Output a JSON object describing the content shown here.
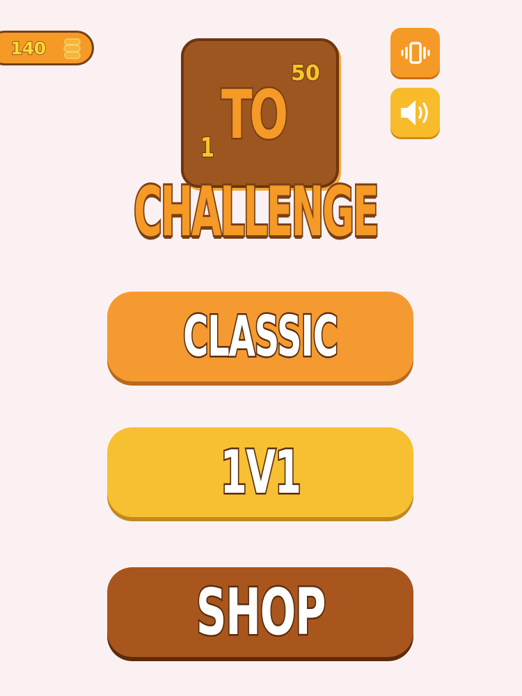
{
  "hud": {
    "coins": "140",
    "coin_icon": "coin-stack-icon",
    "vibration_icon": "vibration-icon",
    "sound_icon": "speaker-icon"
  },
  "logo": {
    "to": "TO",
    "one": "1",
    "fifty": "50",
    "challenge": "CHALLENGE"
  },
  "menu": {
    "classic": "CLASSIC",
    "versus": "1V1",
    "shop": "SHOP"
  },
  "colors": {
    "background": "#fbf1f3",
    "orange": "#f59a30",
    "yellow": "#f7c033",
    "brown": "#a9561e",
    "outline": "#7a3f14"
  }
}
